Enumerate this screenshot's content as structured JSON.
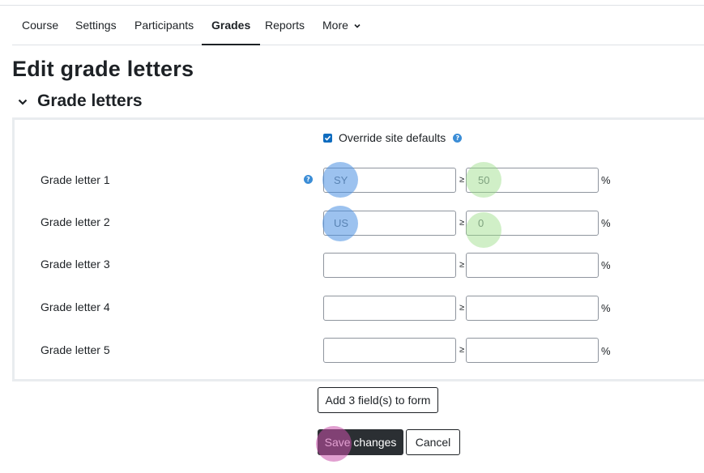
{
  "nav": {
    "items": [
      {
        "label": "Course"
      },
      {
        "label": "Settings"
      },
      {
        "label": "Participants"
      },
      {
        "label": "Grades"
      },
      {
        "label": "Reports"
      },
      {
        "label": "More"
      }
    ],
    "active": "Grades"
  },
  "page": {
    "title": "Edit grade letters",
    "section_title": "Grade letters"
  },
  "form": {
    "override_label": "Override site defaults",
    "override_checked": true,
    "rows": [
      {
        "label": "Grade letter 1",
        "letter": "SY",
        "boundary": "50"
      },
      {
        "label": "Grade letter 2",
        "letter": "US",
        "boundary": "0"
      },
      {
        "label": "Grade letter 3",
        "letter": "",
        "boundary": ""
      },
      {
        "label": "Grade letter 4",
        "letter": "",
        "boundary": ""
      },
      {
        "label": "Grade letter 5",
        "letter": "",
        "boundary": ""
      }
    ],
    "ge_symbol": "≥",
    "percent_symbol": "%"
  },
  "buttons": {
    "add_fields": "Add 3 field(s) to form",
    "save": "Save changes",
    "cancel": "Cancel"
  },
  "icons": {
    "help": "help-icon",
    "chevron": "chevron-down-icon",
    "checkbox": "checkbox-checked"
  },
  "colors": {
    "primary": "#0f6cbf",
    "dark_button": "#2b2f33"
  }
}
